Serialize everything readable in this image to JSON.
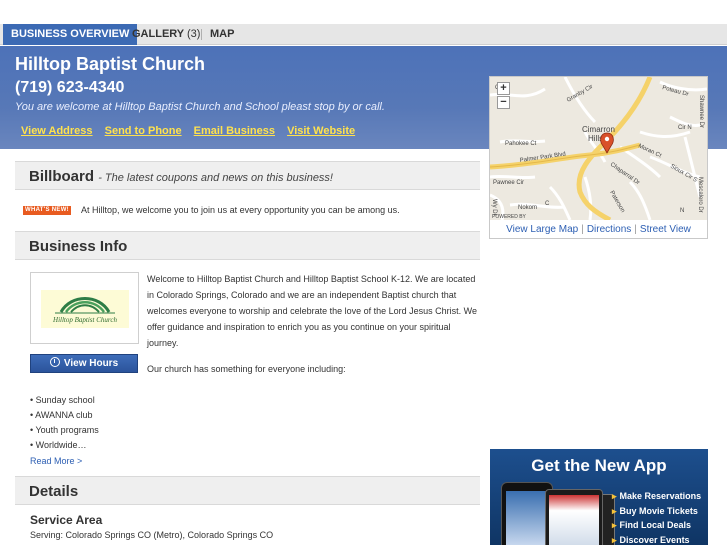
{
  "tabs": [
    {
      "label": "BUSINESS OVERVIEW",
      "active": true
    },
    {
      "label": "GALLERY",
      "count": "(3)"
    },
    {
      "label": "MAP"
    }
  ],
  "business": {
    "name": "Hilltop Baptist Church",
    "phone": "(719) 623-4340",
    "tagline": "You are welcome at Hilltop Baptist Church and School pleast stop by or call.",
    "links": [
      "View Address",
      "Send to Phone",
      "Email Business",
      "Visit Website"
    ]
  },
  "map": {
    "zoom_in": "+",
    "zoom_out": "−",
    "labels": {
      "cimarron": "Cimarron",
      "hills": "Hills",
      "palmer_park": "Palmer Park Blvd",
      "pahokee": "Pahokee Ct",
      "pawnee": "Pawnee Cir",
      "chaparral": "Chaparral Dr",
      "moran": "Moran Ct",
      "sioux": "Sioux Cir S",
      "nokomis": "Nokom",
      "granby": "Granby Cir",
      "poteau": "Poteau Dr",
      "shawnee": "Shawnee Dr",
      "nez": "Cir N",
      "paterson": "Paterson",
      "mescalero": "Mescalero Dr",
      "wy": "Wy Dr",
      "powered": "POWERED BY",
      "n": "N",
      "ct": "Ct",
      "c": "C"
    },
    "links": [
      "View Large Map",
      "Directions",
      "Street View"
    ],
    "separator": "|"
  },
  "billboard": {
    "title": "Billboard",
    "subtitle": "- The latest coupons and news on this business!",
    "badge": "WHAT'S NEW!",
    "text": "At Hilltop, we welcome you to join us at every opportunity you can be among us."
  },
  "business_info": {
    "title": "Business Info",
    "logo_text": "Hilltop Baptist Church",
    "hours_button": "View Hours",
    "description": "Welcome to Hilltop Baptist Church and Hilltop Baptist School K-12. We are located in Colorado Springs, Colorado and we are an independent Baptist church that welcomes everyone to worship and celebrate the love of the Lord Jesus Christ. We offer guidance and inspiration to enrich you as you continue on your spiritual journey.",
    "description2": "Our church has something for everyone including:",
    "bullets": [
      "• Sunday school",
      "• AWANNA club",
      "• Youth programs",
      "• Worldwide…"
    ],
    "read_more": "Read More >"
  },
  "details": {
    "title": "Details",
    "service_area_title": "Service Area",
    "service_area_text": "Serving: Colorado Springs CO (Metro), Colorado Springs CO"
  },
  "ad": {
    "title": "Get the New App",
    "items": [
      "Make Reservations",
      "Buy Movie Tickets",
      "Find Local Deals",
      "Discover Events"
    ],
    "arrow": "▸"
  },
  "colors": {
    "accent": "#3c6ab4",
    "header": "#5778b7",
    "link_yellow": "#ffe24d",
    "link_blue": "#2d5fb3",
    "badge": "#e85b20",
    "map_pin": "#d9502a"
  }
}
